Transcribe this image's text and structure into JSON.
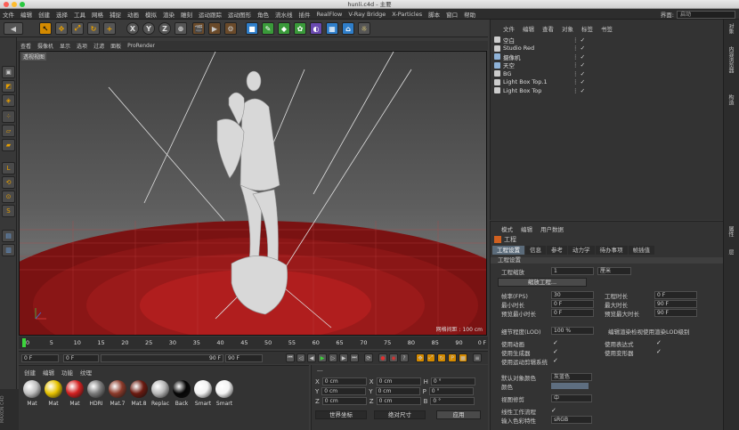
{
  "window": {
    "title": "hunli.c4d - 主要"
  },
  "menu": [
    "文件",
    "编辑",
    "创建",
    "选择",
    "工具",
    "网格",
    "捕捉",
    "动画",
    "模拟",
    "渲染",
    "雕刻",
    "运动跟踪",
    "运动图形",
    "角色",
    "流水线",
    "插件",
    "RealFlow",
    "V-Ray Bridge",
    "X-Particles",
    "脚本",
    "窗口",
    "帮助"
  ],
  "interface": {
    "label": "界面:",
    "value": "启动"
  },
  "viewport": {
    "menu": [
      "查看",
      "摄像机",
      "显示",
      "选项",
      "过滤",
      "面板",
      "ProRender"
    ],
    "label": "透视视图",
    "grid_spacing": "网格间距 : 100 cm"
  },
  "timeline": {
    "ticks": [
      "0",
      "5",
      "10",
      "15",
      "20",
      "25",
      "30",
      "35",
      "40",
      "45",
      "50",
      "55",
      "60",
      "65",
      "70",
      "75",
      "80",
      "85",
      "90"
    ],
    "end_frame": "0 F"
  },
  "playback": {
    "start": "0 F",
    "current": "0 F",
    "range_end": "90 F",
    "end": "90 F"
  },
  "material_manager": {
    "menu": [
      "创建",
      "编辑",
      "功能",
      "纹理"
    ],
    "materials": [
      {
        "name": "Mat",
        "color": "#c0c0c0"
      },
      {
        "name": "Mat",
        "color": "#e6c200"
      },
      {
        "name": "Mat",
        "color": "#d22020"
      },
      {
        "name": "HDRI",
        "color": "#7a7a7a"
      },
      {
        "name": "Mat.7",
        "color": "#8b3a2a"
      },
      {
        "name": "Mat.8",
        "color": "#6a1a10"
      },
      {
        "name": "Replac",
        "color": "#b8b8b8"
      },
      {
        "name": "Back",
        "color": "#050505"
      },
      {
        "name": "Smart",
        "color": "#f2f2f2"
      },
      {
        "name": "Smart",
        "color": "#f4f4f4"
      }
    ]
  },
  "coordinates": {
    "header": "---",
    "rows": [
      {
        "a": "X",
        "av": "0 cm",
        "b": "X",
        "bv": "0 cm",
        "c": "H",
        "cv": "0 °"
      },
      {
        "a": "Y",
        "av": "0 cm",
        "b": "Y",
        "bv": "0 cm",
        "c": "P",
        "cv": "0 °"
      },
      {
        "a": "Z",
        "av": "0 cm",
        "b": "Z",
        "bv": "0 cm",
        "c": "B",
        "cv": "0 °"
      }
    ],
    "mode": "世界坐标",
    "scale": "绝对尺寸",
    "apply": "应用"
  },
  "object_manager": {
    "menu": [
      "文件",
      "编辑",
      "查看",
      "对象",
      "标签",
      "书签"
    ],
    "objects": [
      {
        "name": "空白",
        "color": "#cccccc"
      },
      {
        "name": "Studio Red",
        "color": "#cccccc"
      },
      {
        "name": "摄像机",
        "color": "#8fb3d9"
      },
      {
        "name": "天空",
        "color": "#8fb3d9"
      },
      {
        "name": "BG",
        "color": "#cccccc"
      },
      {
        "name": "Light Box Top.1",
        "color": "#cccccc"
      },
      {
        "name": "Light Box Top",
        "color": "#cccccc"
      }
    ]
  },
  "attributes": {
    "menu": [
      "模式",
      "编辑",
      "用户数据"
    ],
    "title": "工程",
    "tabs": [
      "工程设置",
      "信息",
      "参考",
      "动力学",
      "待办事项",
      "帧插值"
    ],
    "section": "工程设置",
    "scale_label": "工程缩放",
    "scale_value": "1",
    "scale_unit": "厘米",
    "scale_button": "缩放工程...",
    "left_fields": [
      {
        "label": "帧率(FPS)",
        "value": "30"
      },
      {
        "label": "最小时长",
        "value": "0 F"
      },
      {
        "label": "预览最小时长",
        "value": "0 F"
      }
    ],
    "right_fields": [
      {
        "label": "工程时长",
        "value": "0 F"
      },
      {
        "label": "最大时长",
        "value": "90 F"
      },
      {
        "label": "预览最大时长",
        "value": "90 F"
      }
    ],
    "lod_label": "细节程度(LOD)",
    "lod_value": "100 %",
    "lod_note": "编辑渲染检视使用渲染LOD级别",
    "checks_left": [
      "使用动画",
      "使用生成器",
      "使用运动剪辑系统"
    ],
    "checks_right": [
      "使用表达式",
      "使用变形器"
    ],
    "default_color_label": "默认对象颜色",
    "default_color_value": "灰蓝色",
    "color_label": "颜色",
    "view_clip_label": "视图修剪",
    "view_clip_value": "中",
    "linear_label": "线性工作流程",
    "input_label": "输入色彩特性",
    "input_value": "sRGB"
  }
}
